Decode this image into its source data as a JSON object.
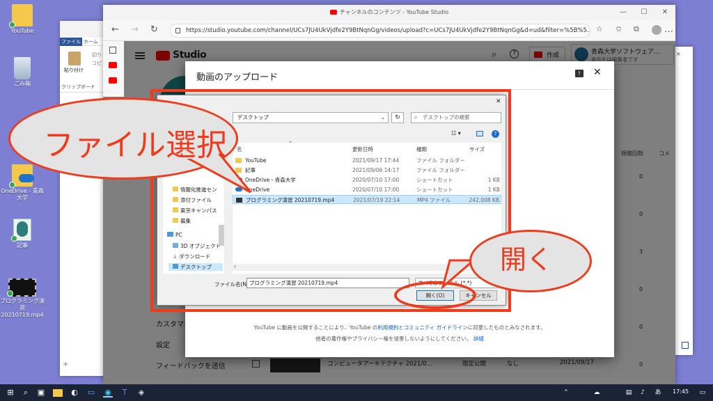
{
  "desktop": {
    "icons": [
      {
        "label": "YouTube"
      },
      {
        "label": "ごみ箱"
      },
      {
        "label": "OneDrive - 青森大学"
      },
      {
        "label": "記事"
      },
      {
        "label": "プログラミング演習 20210719.mp4"
      }
    ]
  },
  "word": {
    "tab_file": "ファイル",
    "tab_home": "ホーム",
    "paste": "貼り付け",
    "clipboard": "クリップボード",
    "cut": "切り",
    "copy": "コピ"
  },
  "browser": {
    "title": "チャンネルのコンテンツ - YouTube Studio",
    "url": "https://studio.youtube.com/channel/UCs7JU4UkVjdfe2Y9BtNqnGg/videos/upload?c=UCs7JU4UkVjdfe2Y9BtNqnGg&d=ud&filter=%5B%5..."
  },
  "studio": {
    "logo": "Studio",
    "create": "作成",
    "account_name": "青森大学ソフトウェア...",
    "account_role": "あなたは編集者です",
    "col_views": "視聴回数",
    "col_comments": "コメ",
    "view_counts": [
      "0",
      "0",
      "3",
      "0",
      "0",
      "2",
      "0"
    ],
    "nav": {
      "custom": "カスタマイ",
      "settings": "設定",
      "feedback": "フィードバックを送信"
    },
    "bottom_row": {
      "title": "コンピュータアーキテクチャ 2021/0...",
      "visibility": "限定公開",
      "restriction": "なし",
      "date": "2021/09/17"
    }
  },
  "upload_dialog": {
    "title": "動画のアップロード",
    "footer_line1_a": "YouTube に動画を公開することにより、YouTube の",
    "footer_link_terms": "利用規約",
    "footer_and": "と",
    "footer_link_guidelines": "コミュニティ ガイドライン",
    "footer_line1_b": "に同意したものとみなされます。",
    "footer_line2": "他者の著作権やプライバシー権を侵害しないようにしてください。",
    "footer_details": "詳細"
  },
  "file_dialog": {
    "path": "デスクトップ",
    "search_placeholder": "デスクトップの検索",
    "columns": {
      "name": "名",
      "date": "更新日時",
      "type": "種類",
      "size": "サイズ"
    },
    "files": [
      {
        "name": "YouTube",
        "date": "2021/09/17 17:44",
        "type": "ファイル フォルダー",
        "size": ""
      },
      {
        "name": "記事",
        "date": "2021/09/06 14:17",
        "type": "ファイル フォルダー",
        "size": ""
      },
      {
        "name": "OneDrive - 青森大学",
        "date": "2020/07/10 17:00",
        "type": "ショートカット",
        "size": "1 KB"
      },
      {
        "name": "OneDrive",
        "date": "2020/07/10 17:00",
        "type": "ショートカット",
        "size": "1 KB"
      },
      {
        "name": "プログラミング演習 20210719.mp4",
        "date": "2021/07/19 22:14",
        "type": "MP4 ファイル",
        "size": "242,008 KB"
      }
    ],
    "tree": [
      "情報化推進セン",
      "添付ファイル",
      "東京キャンパス",
      "募集",
      "PC",
      "3D オブジェクト",
      "ダウンロード",
      "デスクトップ"
    ],
    "filename_label": "ファイル名(N):",
    "filename_value": "プログラミング演習 20210719.mp4",
    "filter": "すべてのファイル (*.*)",
    "open": "開く(O)",
    "cancel": "キャンセル"
  },
  "annotations": {
    "select_file": "ファイル選択",
    "open": "開く"
  },
  "taskbar": {
    "time": "17:45"
  },
  "colors": {
    "annotation_red": "#ef3b1c",
    "desktop": "#7c7fd2",
    "selected_row": "#cce8ff",
    "youtube_red": "#ff0000"
  }
}
